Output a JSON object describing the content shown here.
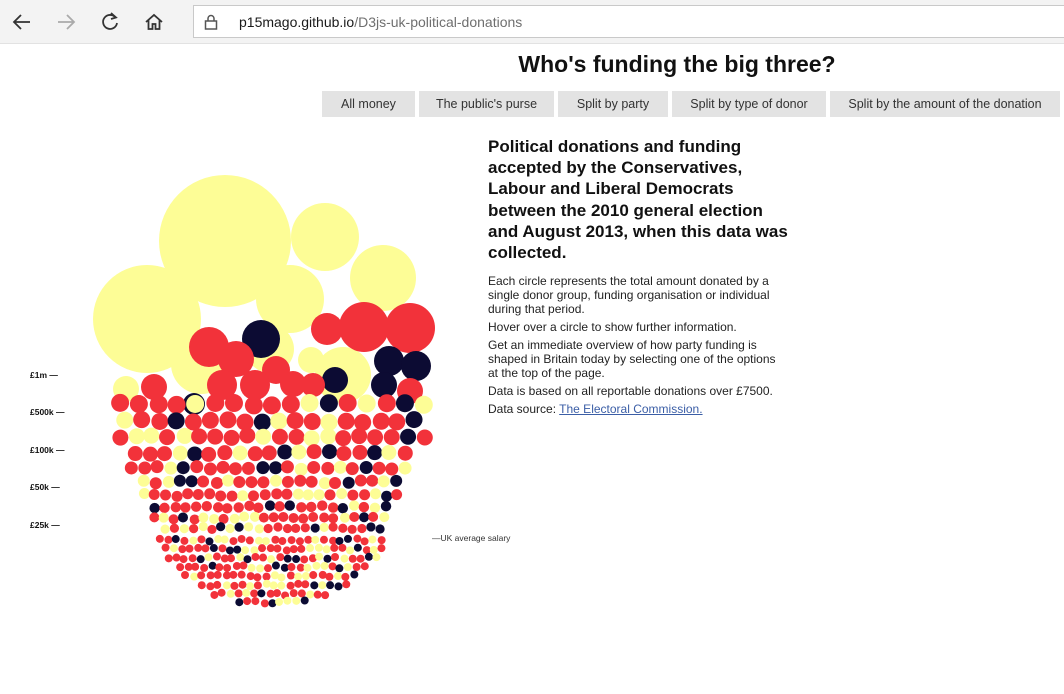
{
  "browser": {
    "url_host": "p15mago.github.io",
    "url_path": "/D3js-uk-political-donations"
  },
  "page": {
    "title": "Who's funding the big three?",
    "menu": [
      "All money",
      "The public's purse",
      "Split by party",
      "Split by type of donor",
      "Split by the amount of the donation"
    ]
  },
  "chart": {
    "scale_labels": [
      "£1m —",
      "£500k —",
      "£100k —",
      "£50k —",
      "£25k —"
    ],
    "salary_label": "—UK average salary",
    "colors": {
      "conservative": "#0c0b33",
      "labour": "#f2323a",
      "libdem": "#fdfd96"
    }
  },
  "info": {
    "heading": "Political donations and funding accepted by the Conservatives, Labour and Liberal Democrats between the 2010 general election and August 2013, when this data was collected.",
    "p1": "Each circle represents the total amount donated by a single donor group, funding organisation or individual during that period.",
    "p2": "Hover over a circle to show further information.",
    "p3": "Get an immediate overview of how party funding is shaped in Britain today by selecting one of the options at the top of the page.",
    "p4": "Data is based on all reportable donations over £7500.",
    "source_prefix": "Data source:",
    "source_link": "The Electoral Commission."
  }
}
